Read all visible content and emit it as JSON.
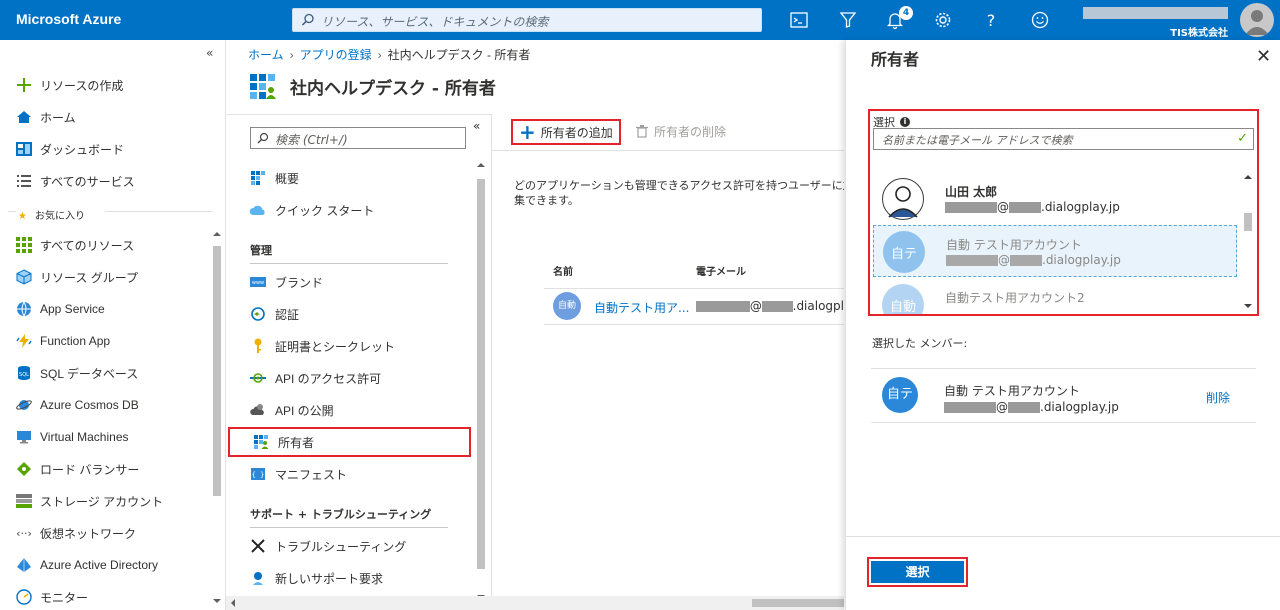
{
  "header": {
    "brand": "Microsoft Azure",
    "search_placeholder": "リソース、サービス、ドキュメントの検索",
    "notification_count": "4",
    "company": "TIS株式会社"
  },
  "leftnav": {
    "collapse": "«",
    "create": "リソースの作成",
    "home": "ホーム",
    "dashboard": "ダッシュボード",
    "all_services": "すべてのサービス",
    "favorites": "お気に入り",
    "items": [
      {
        "label": "すべてのリソース",
        "icon": "grid-icon"
      },
      {
        "label": "リソース グループ",
        "icon": "cube-icon"
      },
      {
        "label": "App Service",
        "icon": "globe-icon"
      },
      {
        "label": "Function App",
        "icon": "bolt-icon"
      },
      {
        "label": "SQL データベース",
        "icon": "sql-icon"
      },
      {
        "label": "Azure Cosmos DB",
        "icon": "planet-icon"
      },
      {
        "label": "Virtual Machines",
        "icon": "monitor-icon"
      },
      {
        "label": "ロード バランサー",
        "icon": "diamond-icon"
      },
      {
        "label": "ストレージ アカウント",
        "icon": "storage-icon"
      },
      {
        "label": "仮想ネットワーク",
        "icon": "network-icon"
      },
      {
        "label": "Azure Active Directory",
        "icon": "aad-icon"
      },
      {
        "label": "モニター",
        "icon": "gauge-icon"
      }
    ]
  },
  "breadcrumb": {
    "home": "ホーム",
    "app_reg": "アプリの登録",
    "current": "社内ヘルプデスク - 所有者"
  },
  "page": {
    "title": "社内ヘルプデスク - 所有者"
  },
  "inner_menu": {
    "search_placeholder": "検索 (Ctrl+/)",
    "collapse": "«",
    "overview": "概要",
    "quickstart": "クイック スタート",
    "section_manage": "管理",
    "manage_items": [
      {
        "label": "ブランド"
      },
      {
        "label": "認証"
      },
      {
        "label": "証明書とシークレット"
      },
      {
        "label": "API のアクセス許可"
      },
      {
        "label": "API の公開"
      },
      {
        "label": "所有者"
      },
      {
        "label": "マニフェスト"
      }
    ],
    "section_support": "サポート + トラブルシューティング",
    "support_items": [
      {
        "label": "トラブルシューティング"
      },
      {
        "label": "新しいサポート要求"
      }
    ]
  },
  "toolbar": {
    "add_owner": "所有者の追加",
    "remove_owner": "所有者の削除"
  },
  "main": {
    "desc_line1": "どのアプリケーションも管理できるアクセス許可を持つユーザーに加え",
    "desc_line2": "集できます。",
    "col_name": "名前",
    "col_email": "電子メール",
    "row": {
      "avatar": "自動",
      "name": "自動テスト用ア...",
      "email_at": "@",
      "email_domain": ".dialogpl"
    }
  },
  "panel": {
    "title": "所有者",
    "close": "✕",
    "select_label": "選択",
    "search_placeholder": "名前または電子メール アドレスで検索",
    "results": [
      {
        "name": "山田 太郎",
        "at": "@",
        "domain": ".dialogplay.jp",
        "avatar": ""
      },
      {
        "name": "自動 テスト用アカウント",
        "at": "@",
        "domain": ".dialogplay.jp",
        "avatar": "自テ"
      },
      {
        "name": "自動テスト用アカウント2",
        "avatar": "自動"
      }
    ],
    "members_label": "選択した メンバー:",
    "member": {
      "avatar": "自テ",
      "name": "自動 テスト用アカウント",
      "at": "@",
      "domain": ".dialogplay.jp",
      "remove": "削除"
    },
    "select_button": "選択"
  },
  "colors": {
    "brand_blue": "#0072c6",
    "highlight_red": "#e3242b"
  }
}
